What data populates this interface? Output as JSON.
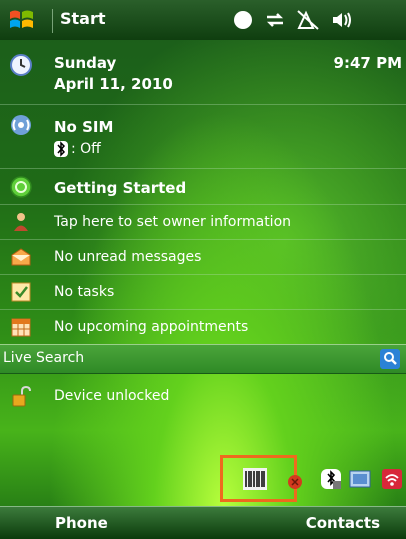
{
  "title_bar": {
    "title": "Start",
    "status_icons": [
      "connectivity-icon",
      "sync-arrows-icon",
      "signal-off-icon",
      "volume-icon"
    ]
  },
  "today": {
    "day": "Sunday",
    "date": "April 11, 2010",
    "time": "9:47 PM"
  },
  "sim": {
    "title": "No SIM",
    "bluetooth_status": ": Off"
  },
  "items": [
    {
      "label": "Getting Started",
      "icon": "getting-started-icon"
    },
    {
      "label": "Tap here to set owner information",
      "icon": "owner-icon"
    },
    {
      "label": "No unread messages",
      "icon": "messages-icon"
    },
    {
      "label": "No tasks",
      "icon": "tasks-icon"
    },
    {
      "label": "No upcoming appointments",
      "icon": "calendar-icon"
    }
  ],
  "live_search": {
    "label": "Live Search"
  },
  "device": {
    "label": "Device unlocked"
  },
  "softkeys": {
    "left": "Phone",
    "right": "Contacts"
  },
  "colors": {
    "highlight": "#ee6a1e"
  }
}
